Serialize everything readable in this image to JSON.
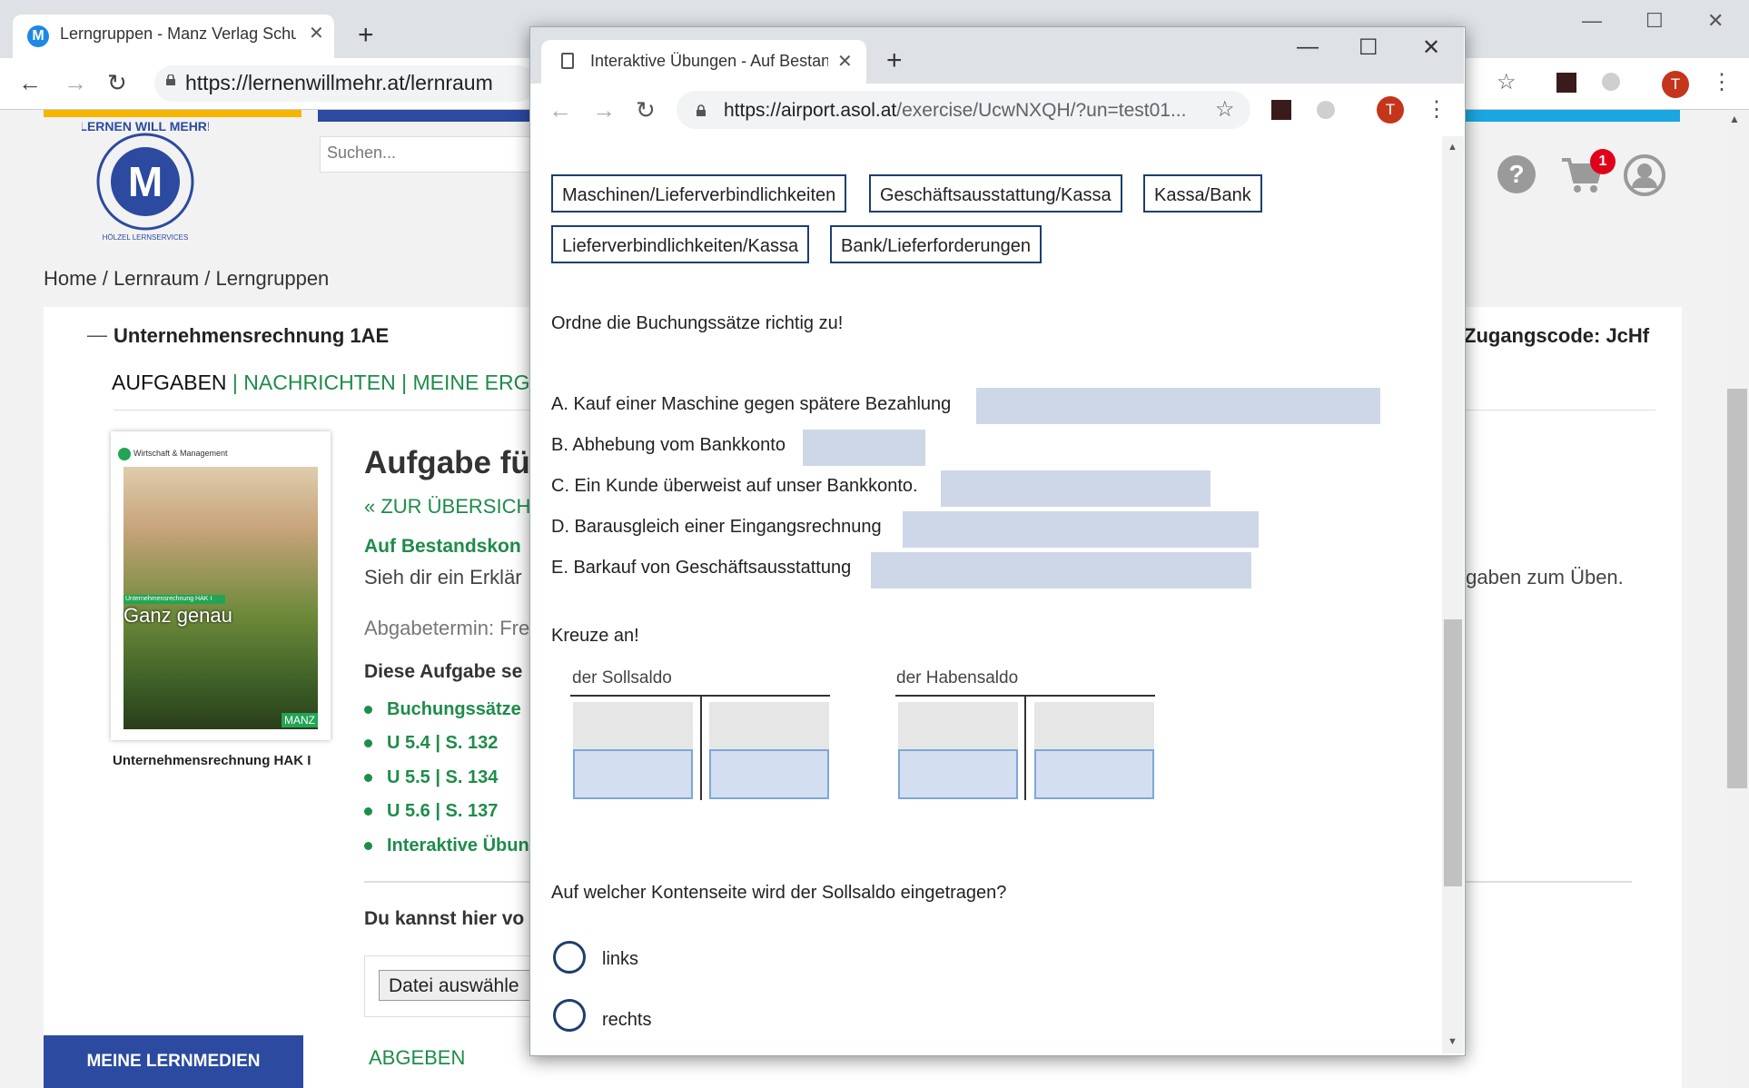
{
  "bg_browser": {
    "tab_title": "Lerngruppen - Manz Verlag Schu",
    "favicon_letter": "M",
    "url": "https://lernenwillmehr.at/lernraum",
    "avatar_letter": "T"
  },
  "header": {
    "search_placeholder": "Suchen...",
    "cart_count": "1",
    "logo_text": "LERNEN WILL MEHR!",
    "logo_subtext": "HÖLZEL LERNSERVICES"
  },
  "breadcrumb": "Home / Lernraum / Lerngruppen",
  "group": {
    "title": "Unternehmensrechnung 1AE",
    "access_code": "Zugangscode: JcHf",
    "tabs": [
      {
        "label": "AUFGABEN"
      },
      {
        "label": "NACHRICHTEN"
      },
      {
        "label": "MEINE ERGE"
      }
    ]
  },
  "book": {
    "series": "Wirtschaft & Management",
    "ribbon": "Unternehmensrechnung HAK I",
    "title": "Ganz genau",
    "publisher": "MANZ",
    "caption": "Unternehmensrechnung HAK I"
  },
  "task": {
    "heading": "Aufgabe fü",
    "back_link": "« ZUR ÜBERSICH",
    "subheading": "Auf Bestandskon",
    "intro": "Sieh dir ein Erklär",
    "intro_tail": "fgaben zum Üben.",
    "deadline": "Abgabetermin: Fre",
    "list_heading": "Diese Aufgabe se",
    "items": [
      "Buchungssätze",
      "U 5.4 | S. 132",
      "U 5.5 | S. 134",
      "U 5.6 | S. 137",
      "Interaktive Übun"
    ],
    "upload_heading": "Du kannst hier vo",
    "file_button": "Datei auswähle",
    "submit": "ABGEBEN"
  },
  "sidebar_button": "MEINE LERNMEDIEN",
  "popup": {
    "tab_title": "Interaktive Übungen - Auf Bestan",
    "url_host": "https://airport.asol.at",
    "url_rest": "/exercise/UcwNXQH/?un=test01...",
    "avatar_letter": "T",
    "chips_row1": [
      "Maschinen/Lieferverbindlichkeiten",
      "Geschäftsausstattung/Kassa",
      "Kassa/Bank"
    ],
    "chips_row2": [
      "Lieferverbindlichkeiten/Kassa",
      "Bank/Lieferforderungen"
    ],
    "instruction1": "Ordne die Buchungssätze richtig zu!",
    "questions": [
      "A. Kauf einer Maschine gegen spätere Bezahlung",
      "B. Abhebung vom Bankkonto",
      "C. Ein Kunde überweist auf unser Bankkonto.",
      "D. Barausgleich einer Eingangsrechnung",
      "E. Barkauf von Geschäftsausstattung"
    ],
    "instruction2": "Kreuze an!",
    "t_accounts": [
      "der Sollsaldo",
      "der Habensaldo"
    ],
    "question3": "Auf welcher Kontenseite wird der Sollsaldo eingetragen?",
    "options": [
      "links",
      "rechts"
    ]
  }
}
